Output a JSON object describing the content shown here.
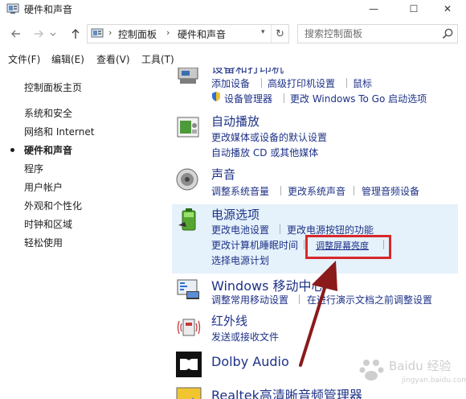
{
  "window": {
    "title": "硬件和声音",
    "minimize": "—",
    "maximize": "☐",
    "close": "✕"
  },
  "address": {
    "crumbs": [
      "控制面板",
      "硬件和声音"
    ],
    "search_placeholder": "搜索控制面板"
  },
  "menu": [
    "文件(F)",
    "编辑(E)",
    "查看(V)",
    "工具(T)"
  ],
  "sidebar": {
    "home": "控制面板主页",
    "items": [
      "系统和安全",
      "网络和 Internet",
      "硬件和声音",
      "程序",
      "用户帐户",
      "外观和个性化",
      "时钟和区域",
      "轻松使用"
    ],
    "current_index": 2
  },
  "categories": {
    "devices": {
      "title": "设备和打印机",
      "links": [
        "添加设备",
        "高级打印机设置",
        "鼠标",
        "设备管理器",
        "更改 Windows To Go 启动选项"
      ]
    },
    "autoplay": {
      "title": "自动播放",
      "links": [
        "更改媒体或设备的默认设置",
        "自动播放 CD 或其他媒体"
      ]
    },
    "sound": {
      "title": "声音",
      "links": [
        "调整系统音量",
        "更改系统声音",
        "管理音频设备"
      ]
    },
    "power": {
      "title": "电源选项",
      "links": [
        "更改电池设置",
        "更改电源按钮的功能",
        "更改计算机睡眠时间",
        "调整屏幕亮度",
        "选择电源计划"
      ]
    },
    "mobility": {
      "title": "Windows 移动中心",
      "links": [
        "调整常用移动设置",
        "在进行演示文档之前调整设置"
      ]
    },
    "infrared": {
      "title": "红外线",
      "links": [
        "发送或接收文件"
      ]
    },
    "dolby": {
      "title": "Dolby Audio"
    },
    "realtek": {
      "title": "Realtek高清晰音频管理器"
    }
  },
  "watermark": {
    "text": "Baidu 经验",
    "sub": "jingyan.baidu.com"
  },
  "colors": {
    "link": "#1e3287",
    "highlight_bg": "#e5f1fb",
    "annotation": "#d8282b",
    "arrow": "#8b1a1a"
  }
}
